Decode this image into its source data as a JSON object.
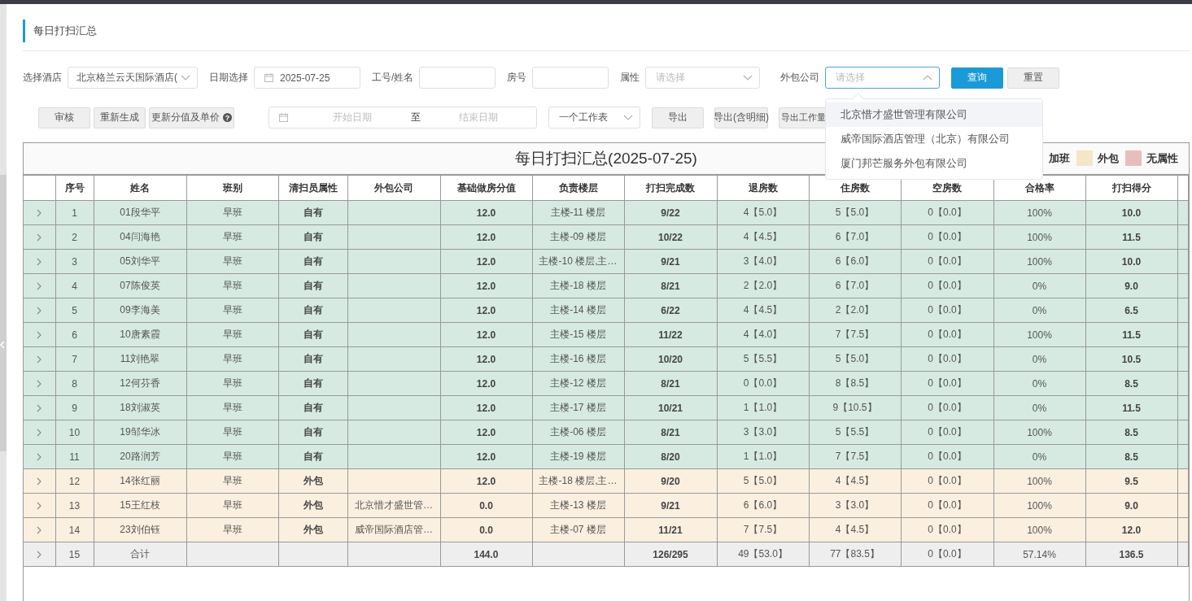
{
  "page_title": "每日打扫汇总",
  "filters": {
    "hotel": {
      "label": "选择酒店",
      "value": "北京格兰云天国际酒店("
    },
    "date": {
      "label": "日期选择",
      "value": "2025-07-25"
    },
    "staff": {
      "label": "工号/姓名"
    },
    "room": {
      "label": "房号"
    },
    "attribute": {
      "label": "属性",
      "placeholder": "请选择"
    },
    "outsource": {
      "label": "外包公司",
      "placeholder": "请选择",
      "expanded": true,
      "options": [
        {
          "label": "北京惜才盛世管理有限公司",
          "highlighted": true
        },
        {
          "label": "威帝国际酒店管理（北京）有限公司",
          "highlighted": false
        },
        {
          "label": "厦门邦芒服务外包有限公司",
          "highlighted": false
        }
      ]
    },
    "query_button": "查询",
    "reset_button": "重置"
  },
  "actions": {
    "review": "审核",
    "regenerate": "重新生成",
    "update": "更新分值及单价",
    "help": "?",
    "range": {
      "start_placeholder": "开始日期",
      "separator": "至",
      "end_placeholder": "结束日期"
    },
    "sheet": {
      "value": "一个工作表"
    },
    "exports": [
      "导出",
      "导出(含明细)",
      "导出工作量"
    ]
  },
  "table": {
    "title": "每日打扫汇总(2025-07-25)",
    "legend": [
      {
        "label": "加班"
      },
      {
        "label": "外包",
        "color": "#f5e6c8"
      },
      {
        "label": "无属性",
        "color": "#e6bfbd"
      }
    ],
    "columns": [
      "序号",
      "姓名",
      "班别",
      "清扫员属性",
      "外包公司",
      "基础做房分值",
      "负责楼层",
      "打扫完成数",
      "退房数",
      "住房数",
      "空房数",
      "合格率",
      "打扫得分"
    ],
    "rows": [
      {
        "kind": "own",
        "no": "1",
        "name": "01段华平",
        "shift": "早班",
        "attr": "自有",
        "base": "12.0",
        "floors": "主楼-11 楼层",
        "done": "9/22",
        "checkout": "4【5.0】",
        "occupied": "5【5.0】",
        "vacant": "0【0.0】",
        "rate": "100%",
        "score": "10.0"
      },
      {
        "kind": "own",
        "no": "2",
        "name": "04闫海艳",
        "shift": "早班",
        "attr": "自有",
        "base": "12.0",
        "floors": "主楼-09 楼层",
        "done": "10/22",
        "checkout": "4【4.5】",
        "occupied": "6【7.0】",
        "vacant": "0【0.0】",
        "rate": "100%",
        "score": "11.5"
      },
      {
        "kind": "own",
        "no": "3",
        "name": "05刘华平",
        "shift": "早班",
        "attr": "自有",
        "base": "12.0",
        "floors": "主楼-10 楼层,主…",
        "done": "9/21",
        "checkout": "3【4.0】",
        "occupied": "6【6.0】",
        "vacant": "0【0.0】",
        "rate": "100%",
        "score": "10.0"
      },
      {
        "kind": "own",
        "no": "4",
        "name": "07陈俊英",
        "shift": "早班",
        "attr": "自有",
        "base": "12.0",
        "floors": "主楼-18 楼层",
        "done": "8/21",
        "checkout": "2【2.0】",
        "occupied": "6【7.0】",
        "vacant": "0【0.0】",
        "rate": "0%",
        "score": "9.0"
      },
      {
        "kind": "own",
        "no": "5",
        "name": "09李海美",
        "shift": "早班",
        "attr": "自有",
        "base": "12.0",
        "floors": "主楼-14 楼层",
        "done": "6/22",
        "checkout": "4【4.5】",
        "occupied": "2【2.0】",
        "vacant": "0【0.0】",
        "rate": "0%",
        "score": "6.5"
      },
      {
        "kind": "own",
        "no": "6",
        "name": "10唐素霞",
        "shift": "早班",
        "attr": "自有",
        "base": "12.0",
        "floors": "主楼-15 楼层",
        "done": "11/22",
        "checkout": "4【4.0】",
        "occupied": "7【7.5】",
        "vacant": "0【0.0】",
        "rate": "100%",
        "score": "11.5"
      },
      {
        "kind": "own",
        "no": "7",
        "name": "11刘艳翠",
        "shift": "早班",
        "attr": "自有",
        "base": "12.0",
        "floors": "主楼-16 楼层",
        "done": "10/20",
        "checkout": "5【5.5】",
        "occupied": "5【5.0】",
        "vacant": "0【0.0】",
        "rate": "0%",
        "score": "10.5"
      },
      {
        "kind": "own",
        "no": "8",
        "name": "12何芬香",
        "shift": "早班",
        "attr": "自有",
        "base": "12.0",
        "floors": "主楼-12 楼层",
        "done": "8/21",
        "checkout": "0【0.0】",
        "occupied": "8【8.5】",
        "vacant": "0【0.0】",
        "rate": "0%",
        "score": "8.5"
      },
      {
        "kind": "own",
        "no": "9",
        "name": "18刘淑英",
        "shift": "早班",
        "attr": "自有",
        "base": "12.0",
        "floors": "主楼-17 楼层",
        "done": "10/21",
        "checkout": "1【1.0】",
        "occupied": "9【10.5】",
        "vacant": "0【0.0】",
        "rate": "0%",
        "score": "11.5"
      },
      {
        "kind": "own",
        "no": "10",
        "name": "19邹华冰",
        "shift": "早班",
        "attr": "自有",
        "base": "12.0",
        "floors": "主楼-06 楼层",
        "done": "8/21",
        "checkout": "3【3.0】",
        "occupied": "5【5.5】",
        "vacant": "0【0.0】",
        "rate": "100%",
        "score": "8.5"
      },
      {
        "kind": "own",
        "no": "11",
        "name": "20路润芳",
        "shift": "早班",
        "attr": "自有",
        "base": "12.0",
        "floors": "主楼-19 楼层",
        "done": "8/20",
        "checkout": "1【1.0】",
        "occupied": "7【7.5】",
        "vacant": "0【0.0】",
        "rate": "0%",
        "score": "8.5"
      },
      {
        "kind": "outsourced",
        "no": "12",
        "name": "14张红丽",
        "shift": "早班",
        "attr": "外包",
        "base": "12.0",
        "floors": "主楼-18 楼层,主…",
        "done": "9/20",
        "checkout": "5【5.0】",
        "occupied": "4【4.5】",
        "vacant": "0【0.0】",
        "rate": "100%",
        "score": "9.5"
      },
      {
        "kind": "outsourced",
        "no": "13",
        "name": "15王红枝",
        "shift": "早班",
        "attr": "外包",
        "company": "北京惜才盛世管…",
        "base": "0.0",
        "floors": "主楼-13 楼层",
        "done": "9/21",
        "checkout": "6【6.0】",
        "occupied": "3【3.0】",
        "vacant": "0【0.0】",
        "rate": "100%",
        "score": "9.0"
      },
      {
        "kind": "outsourced",
        "no": "14",
        "name": "23刘伯钰",
        "shift": "早班",
        "attr": "外包",
        "company": "威帝国际酒店管…",
        "base": "0.0",
        "floors": "主楼-07 楼层",
        "done": "11/21",
        "checkout": "7【7.5】",
        "occupied": "4【4.5】",
        "vacant": "0【0.0】",
        "rate": "100%",
        "score": "12.0"
      },
      {
        "kind": "total",
        "no": "15",
        "name": "合计",
        "base": "144.0",
        "done": "126/295",
        "checkout": "49【53.0】",
        "occupied": "77【83.5】",
        "vacant": "0【0.0】",
        "rate": "57.14%",
        "score": "136.5"
      }
    ]
  }
}
